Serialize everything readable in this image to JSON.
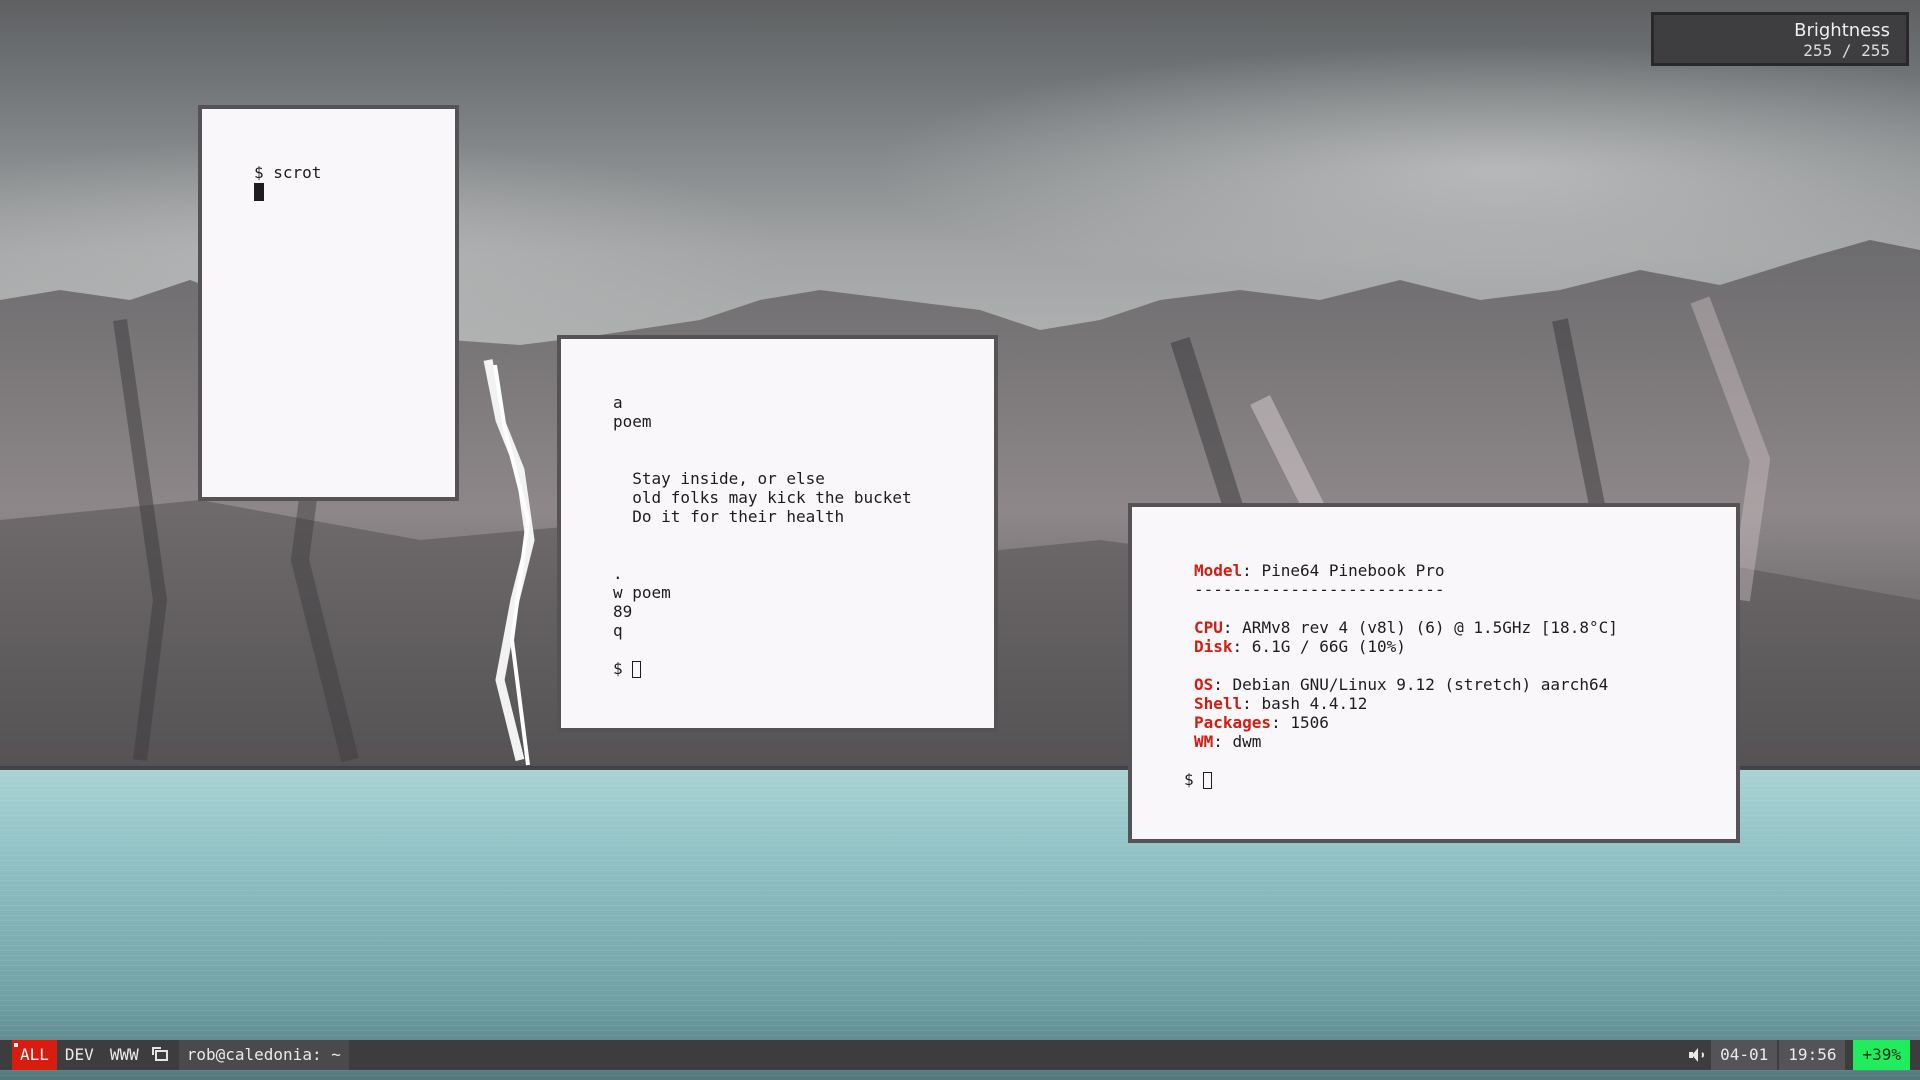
{
  "osd": {
    "title": "Brightness",
    "value": "255 / 255"
  },
  "terminals": {
    "scrot": {
      "lines": [
        "$ scrot"
      ]
    },
    "poem": {
      "lines": [
        "a",
        "poem",
        "",
        "",
        "  Stay inside, or else",
        "  old folks may kick the bucket",
        "  Do it for their health",
        "",
        "",
        ".",
        "w poem",
        "89",
        "q",
        ""
      ],
      "prompt": "$ "
    },
    "neofetch": {
      "model_key": "Model",
      "model_val": ": Pine64 Pinebook Pro",
      "separator": "--------------------------",
      "cpu_key": "CPU",
      "cpu_val": ": ARMv8 rev 4 (v8l) (6) @ 1.5GHz [18.8°C]",
      "disk_key": "Disk",
      "disk_val": ": 6.1G / 66G (10%)",
      "os_key": "OS",
      "os_val": ": Debian GNU/Linux 9.12 (stretch) aarch64",
      "shell_key": "Shell",
      "shell_val": ": bash 4.4.12",
      "packages_key": "Packages",
      "packages_val": ": 1506",
      "wm_key": "WM",
      "wm_val": ": dwm",
      "prompt": "$ "
    }
  },
  "bar": {
    "tags": [
      "ALL",
      "DEV",
      "WWW"
    ],
    "active_tag": "ALL",
    "layout_icon": "floating-layout-icon",
    "window_title": "rob@caledonia: ~",
    "volume_icon": "speaker-icon",
    "date": "04-01",
    "time": "19:56",
    "battery": "+39%"
  },
  "colors": {
    "accent_red": "#d81c0f",
    "battery_green": "#20ec5e",
    "bar_bg": "#3d3c3f",
    "terminal_bg": "#f9f7fa",
    "terminal_border": "#555356"
  }
}
